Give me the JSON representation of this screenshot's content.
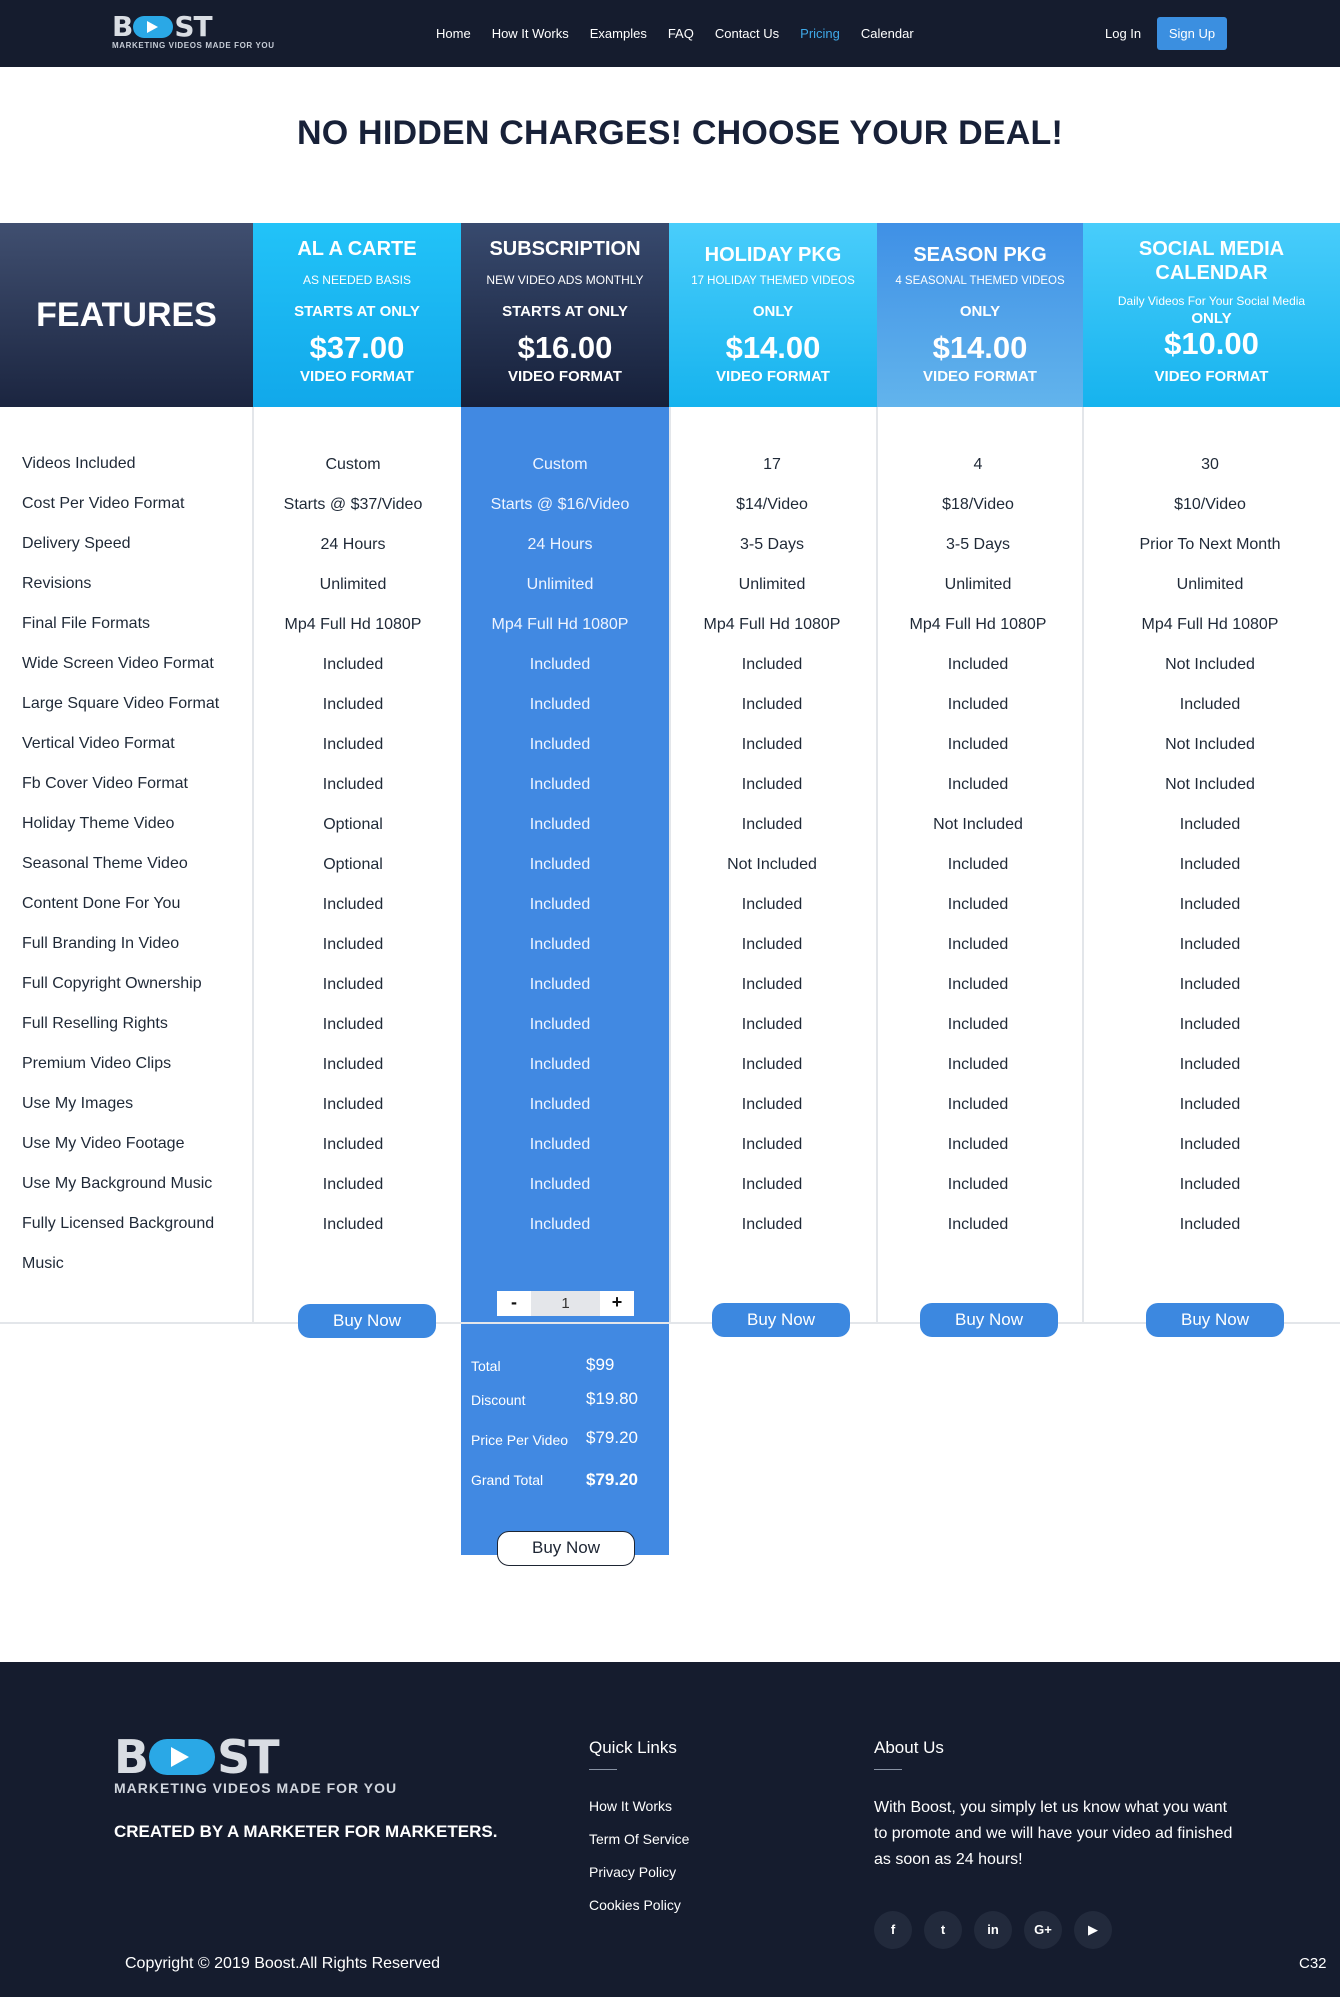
{
  "nav": {
    "logo_word": "BOOST",
    "logo_tagline": "MARKETING VIDEOS MADE FOR YOU",
    "links": [
      "Home",
      "How It Works",
      "Examples",
      "FAQ",
      "Contact Us",
      "Pricing",
      "Calendar"
    ],
    "active_link": "Pricing",
    "login": "Log In",
    "signup": "Sign Up"
  },
  "headline": "NO HIDDEN CHARGES! CHOOSE YOUR DEAL!",
  "features_header": "FEATURES",
  "plans": [
    {
      "name": "AL A CARTE",
      "sub": "AS NEEDED BASIS",
      "starts": "STARTS AT ONLY",
      "price": "$37.00",
      "format": "VIDEO FORMAT",
      "buy": "Buy Now"
    },
    {
      "name": "SUBSCRIPTION",
      "sub": "NEW VIDEO ADS MONTHLY",
      "starts": "STARTS AT ONLY",
      "price": "$16.00",
      "format": "VIDEO FORMAT",
      "buy": "Buy Now"
    },
    {
      "name": "HOLIDAY PKG",
      "sub": "17 HOLIDAY THEMED  VIDEOS",
      "starts": "ONLY",
      "price": "$14.00",
      "format": "VIDEO FORMAT",
      "buy": "Buy Now"
    },
    {
      "name": "SEASON PKG",
      "sub": "4 SEASONAL THEMED VIDEOS",
      "starts": "ONLY",
      "price": "$14.00",
      "format": "VIDEO FORMAT",
      "buy": "Buy Now"
    },
    {
      "name": "SOCIAL MEDIA CALENDAR",
      "sub": "Daily Videos For Your Social Media",
      "starts": "ONLY",
      "price": "$10.00",
      "format": "VIDEO FORMAT",
      "buy": "Buy Now"
    }
  ],
  "features": [
    "Videos Included",
    "Cost Per Video Format",
    "Delivery Speed",
    "Revisions",
    "Final File Formats",
    "Wide Screen Video Format",
    "Large Square Video Format",
    "Vertical Video Format",
    "Fb Cover Video Format",
    "Holiday Theme Video",
    "Seasonal Theme Video",
    "Content Done For You",
    "Full Branding In Video",
    "Full Copyright Ownership",
    "Full Reselling Rights",
    "Premium Video Clips",
    "Use My Images",
    "Use My Video Footage",
    "Use My Background Music",
    "Fully Licensed Background",
    "Music"
  ],
  "rows": [
    [
      "Custom",
      "Custom",
      "17",
      "4",
      "30"
    ],
    [
      "Starts @ $37/Video",
      "Starts @ $16/Video",
      "$14/Video",
      "$18/Video",
      "$10/Video"
    ],
    [
      "24 Hours",
      "24 Hours",
      "3-5 Days",
      "3-5 Days",
      "Prior To Next Month"
    ],
    [
      "Unlimited",
      "Unlimited",
      "Unlimited",
      "Unlimited",
      "Unlimited"
    ],
    [
      "Mp4 Full Hd 1080P",
      "Mp4 Full Hd 1080P",
      "Mp4 Full Hd 1080P",
      "Mp4 Full Hd 1080P",
      "Mp4 Full Hd 1080P"
    ],
    [
      "Included",
      "Included",
      "Included",
      "Included",
      "Not Included"
    ],
    [
      "Included",
      "Included",
      "Included",
      "Included",
      "Included"
    ],
    [
      "Included",
      "Included",
      "Included",
      "Included",
      "Not Included"
    ],
    [
      "Included",
      "Included",
      "Included",
      "Included",
      "Not Included"
    ],
    [
      "Optional",
      "Included",
      "Included",
      "Not Included",
      "Included"
    ],
    [
      "Optional",
      "Included",
      "Not Included",
      "Included",
      "Included"
    ],
    [
      "Included",
      "Included",
      "Included",
      "Included",
      "Included"
    ],
    [
      "Included",
      "Included",
      "Included",
      "Included",
      "Included"
    ],
    [
      "Included",
      "Included",
      "Included",
      "Included",
      "Included"
    ],
    [
      "Included",
      "Included",
      "Included",
      "Included",
      "Included"
    ],
    [
      "Included",
      "Included",
      "Included",
      "Included",
      "Included"
    ],
    [
      "Included",
      "Included",
      "Included",
      "Included",
      "Included"
    ],
    [
      "Included",
      "Included",
      "Included",
      "Included",
      "Included"
    ],
    [
      "Included",
      "Included",
      "Included",
      "Included",
      "Included"
    ],
    [
      "Included",
      "Included",
      "Included",
      "Included",
      "Included"
    ]
  ],
  "stepper": {
    "minus": "-",
    "value": "1",
    "plus": "+"
  },
  "totals": {
    "total_label": "Total",
    "total_value": "$99",
    "discount_label": "Discount",
    "discount_value": "$19.80",
    "ppv_label": "Price Per Video",
    "ppv_value": "$79.20",
    "grand_label": "Grand Total",
    "grand_value": "$79.20"
  },
  "footer": {
    "logo_word": "BOOST",
    "logo_tagline": "MARKETING VIDEOS MADE FOR YOU",
    "created": "CREATED BY A MARKETER FOR MARKETERS.",
    "quick_links_title": "Quick Links",
    "quick_links": [
      "How It Works",
      "Term Of Service",
      "Privacy Policy",
      "Cookies Policy"
    ],
    "about_title": "About Us",
    "about_text": "With Boost, you simply let us know what you want to promote and we will have your video ad finished as soon as 24 hours!",
    "social": [
      {
        "icon": "facebook-icon",
        "glyph": "f"
      },
      {
        "icon": "twitter-icon",
        "glyph": "t"
      },
      {
        "icon": "linkedin-icon",
        "glyph": "in"
      },
      {
        "icon": "google-plus-icon",
        "glyph": "G+"
      },
      {
        "icon": "youtube-icon",
        "glyph": "▶"
      }
    ],
    "copyright": "Copyright © 2019 Boost.All Rights Reserved",
    "code": "C32"
  },
  "colors": {
    "nav_bg": "#151c2e",
    "accent": "#4189e2",
    "cyan": "#1fb2ef"
  }
}
